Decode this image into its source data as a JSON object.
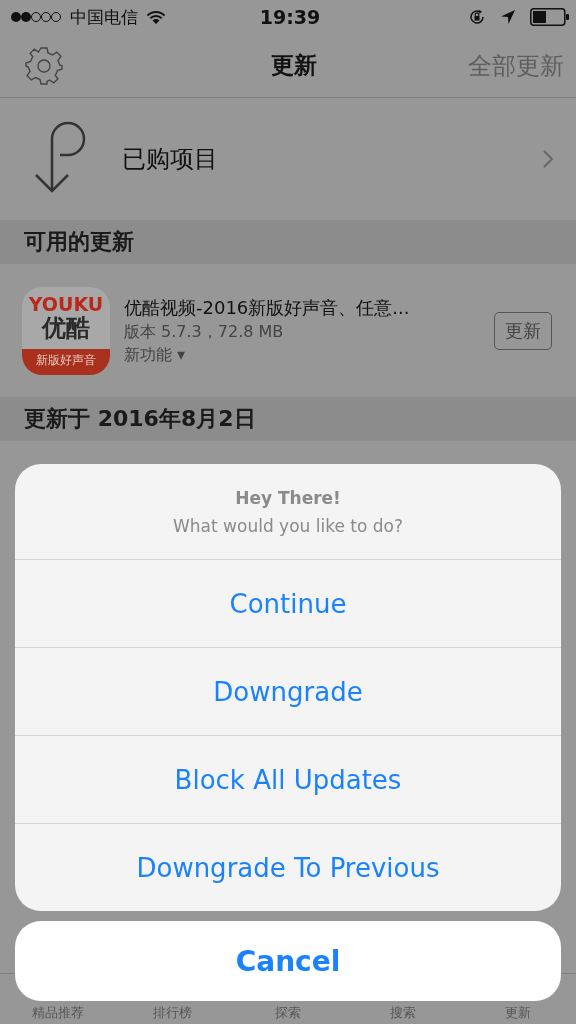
{
  "status_bar": {
    "carrier": "中国电信",
    "time": "19:39"
  },
  "nav": {
    "title": "更新",
    "action": "全部更新"
  },
  "purchased": {
    "label": "已购项目"
  },
  "sections": [
    {
      "header": "可用的更新",
      "apps": [
        {
          "icon": {
            "brand": "YOUKU",
            "name": "优酷",
            "banner": "新版好声音"
          },
          "name": "优酷视频-2016新版好声音、任意...",
          "info": "版本 5.7.3，72.8 MB",
          "whats_new": "新功能 ▾",
          "button": "更新"
        }
      ]
    },
    {
      "header": "更新于 2016年8月2日"
    }
  ],
  "tab_bar": [
    "精品推荐",
    "排行榜",
    "探索",
    "搜索",
    "更新"
  ],
  "action_sheet": {
    "title": "Hey There!",
    "message": "What would you like to do?",
    "actions": [
      "Continue",
      "Downgrade",
      "Block All Updates",
      "Downgrade To Previous"
    ],
    "cancel": "Cancel"
  }
}
